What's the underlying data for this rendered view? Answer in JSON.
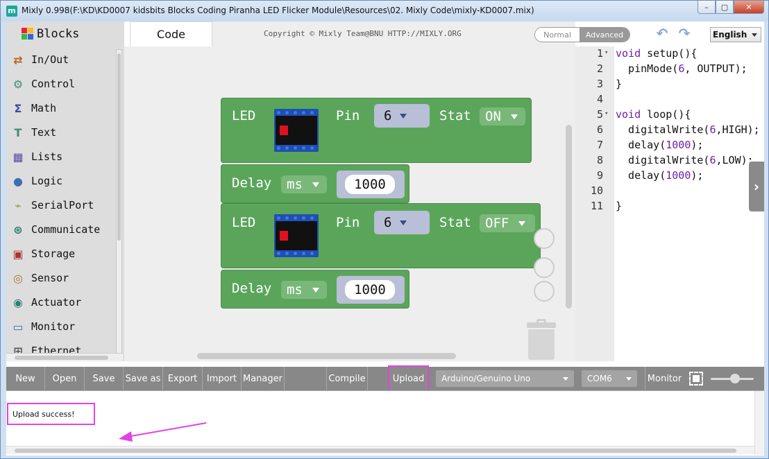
{
  "window": {
    "title": "Mixly 0.998(F:\\KD\\KD0007 kidsbits Blocks Coding Piranha LED Flicker  Module\\Resources\\02. Mixly Code\\mixly-KD0007.mix)",
    "app_icon_letter": "m",
    "minimize": "–",
    "maximize": "▢",
    "close": "✕"
  },
  "toolbox": {
    "title": "Blocks",
    "categories": [
      {
        "label": "In/Out",
        "icon": "arrows-icon",
        "color": "#b5651d",
        "glyph": "⇄"
      },
      {
        "label": "Control",
        "icon": "gears-icon",
        "color": "#3f8f6f",
        "glyph": "⚙"
      },
      {
        "label": "Math",
        "icon": "sigma-icon",
        "color": "#3b4ca0",
        "glyph": "Σ"
      },
      {
        "label": "Text",
        "icon": "text-t-icon",
        "color": "#3f8f6f",
        "glyph": "T"
      },
      {
        "label": "Lists",
        "icon": "lists-icon",
        "color": "#5b4aa6",
        "glyph": "▦"
      },
      {
        "label": "Logic",
        "icon": "bulb-icon",
        "color": "#3d6fb5",
        "glyph": "●"
      },
      {
        "label": "SerialPort",
        "icon": "serial-icon",
        "color": "#8ba63c",
        "glyph": "⌁"
      },
      {
        "label": "Communicate",
        "icon": "satellite-icon",
        "color": "#2f7f6f",
        "glyph": "⊛"
      },
      {
        "label": "Storage",
        "icon": "storage-icon",
        "color": "#a33",
        "glyph": "▣"
      },
      {
        "label": "Sensor",
        "icon": "sensor-icon",
        "color": "#a07a3c",
        "glyph": "◎"
      },
      {
        "label": "Actuator",
        "icon": "actuator-icon",
        "color": "#2f7f6f",
        "glyph": "◉"
      },
      {
        "label": "Monitor",
        "icon": "monitor-icon",
        "color": "#3d6fb5",
        "glyph": "▭"
      },
      {
        "label": "Ethernet",
        "icon": "ethernet-icon",
        "color": "#555",
        "glyph": "⊞"
      }
    ]
  },
  "header": {
    "code_tab": "Code",
    "copyright": "Copyright © Mixly Team@BNU HTTP://MIXLY.ORG",
    "mode_normal": "Normal",
    "mode_advanced": "Advanced",
    "undo": "↶",
    "redo": "↷",
    "language": "English"
  },
  "workspace": {
    "blocks": [
      {
        "kind": "led",
        "label": "LED",
        "pin_label": "Pin",
        "pin": "6",
        "stat_label": "Stat",
        "stat": "ON"
      },
      {
        "kind": "delay",
        "label": "Delay",
        "unit": "ms",
        "value": "1000"
      },
      {
        "kind": "led",
        "label": "LED",
        "pin_label": "Pin",
        "pin": "6",
        "stat_label": "Stat",
        "stat": "OFF"
      },
      {
        "kind": "delay",
        "label": "Delay",
        "unit": "ms",
        "value": "1000"
      }
    ]
  },
  "code": {
    "lines": [
      {
        "n": "1",
        "fold": true,
        "text": "void setup(){"
      },
      {
        "n": "2",
        "fold": false,
        "text": "  pinMode(6, OUTPUT);"
      },
      {
        "n": "3",
        "fold": false,
        "text": "}"
      },
      {
        "n": "4",
        "fold": false,
        "text": ""
      },
      {
        "n": "5",
        "fold": true,
        "text": "void loop(){"
      },
      {
        "n": "6",
        "fold": false,
        "text": "  digitalWrite(6,HIGH);"
      },
      {
        "n": "7",
        "fold": false,
        "text": "  delay(1000);"
      },
      {
        "n": "8",
        "fold": false,
        "text": "  digitalWrite(6,LOW);"
      },
      {
        "n": "9",
        "fold": false,
        "text": "  delay(1000);"
      },
      {
        "n": "10",
        "fold": false,
        "text": ""
      },
      {
        "n": "11",
        "fold": false,
        "text": "}"
      }
    ],
    "toggle_glyph": "›"
  },
  "toolbar": {
    "new": "New",
    "open": "Open",
    "save": "Save",
    "save_as": "Save as",
    "export": "Export",
    "import": "Import",
    "manager": "Manager",
    "compile": "Compile",
    "upload": "Upload",
    "board": "Arduino/Genuino Uno",
    "port": "COM6",
    "monitor": "Monitor"
  },
  "console": {
    "message": "Upload success!"
  },
  "colors": {
    "block_green": "#5ba55b",
    "highlight_magenta": "#e043e5",
    "toolbar_gray": "#888888"
  }
}
